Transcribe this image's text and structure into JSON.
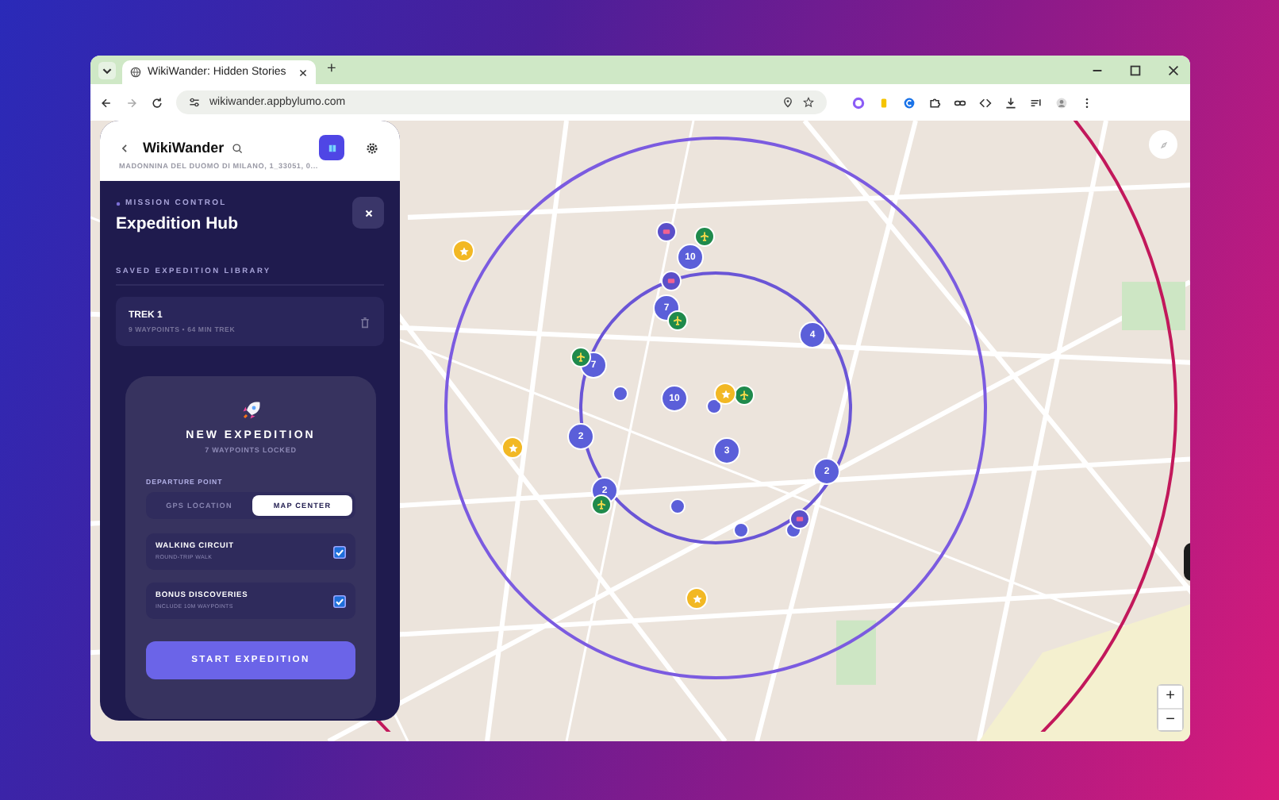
{
  "browser": {
    "tab": {
      "title": "WikiWander: Hidden Stories",
      "selected": true
    },
    "new_tab": "+",
    "address": "wikiwander.appbylumo.com"
  },
  "header": {
    "title": "WikiWander",
    "location": "MADONNINA DEL DUOMO DI MILANO, 1_33051, 0..."
  },
  "hub": {
    "eyebrow": "MISSION CONTROL",
    "title": "Expedition Hub",
    "library_heading": "SAVED EXPEDITION LIBRARY",
    "saved": [
      {
        "name": "TREK 1",
        "meta": "9 WAYPOINTS • 64 MIN TREK"
      }
    ]
  },
  "new_expedition": {
    "title": "NEW EXPEDITION",
    "subtitle": "7 WAYPOINTS LOCKED",
    "departure_label": "DEPARTURE POINT",
    "departure_options": [
      {
        "label": "GPS LOCATION",
        "selected": false
      },
      {
        "label": "MAP CENTER",
        "selected": true
      }
    ],
    "options": [
      {
        "title": "WALKING CIRCUIT",
        "subtitle": "ROUND-TRIP WALK",
        "checked": true
      },
      {
        "title": "BONUS DISCOVERIES",
        "subtitle": "INCLUDE 10M WAYPOINTS",
        "checked": true
      }
    ],
    "start_button": "START EXPEDITION"
  },
  "map": {
    "markers": [
      {
        "kind": "cluster",
        "count": "10"
      },
      {
        "kind": "cluster",
        "count": "7"
      },
      {
        "kind": "cluster",
        "count": "7"
      },
      {
        "kind": "cluster",
        "count": "4"
      },
      {
        "kind": "cluster",
        "count": "10"
      },
      {
        "kind": "cluster",
        "count": "2"
      },
      {
        "kind": "cluster",
        "count": "3"
      },
      {
        "kind": "cluster",
        "count": "2"
      },
      {
        "kind": "cluster",
        "count": "2"
      },
      {
        "kind": "dot"
      },
      {
        "kind": "dot"
      },
      {
        "kind": "dot"
      },
      {
        "kind": "dot"
      },
      {
        "kind": "dot"
      },
      {
        "kind": "ticket"
      },
      {
        "kind": "ticket"
      },
      {
        "kind": "ticket"
      },
      {
        "kind": "green"
      },
      {
        "kind": "green"
      },
      {
        "kind": "green"
      },
      {
        "kind": "green"
      },
      {
        "kind": "green"
      },
      {
        "kind": "star"
      },
      {
        "kind": "star"
      },
      {
        "kind": "star"
      },
      {
        "kind": "star"
      }
    ],
    "zoom": [
      "+",
      "−"
    ]
  }
}
